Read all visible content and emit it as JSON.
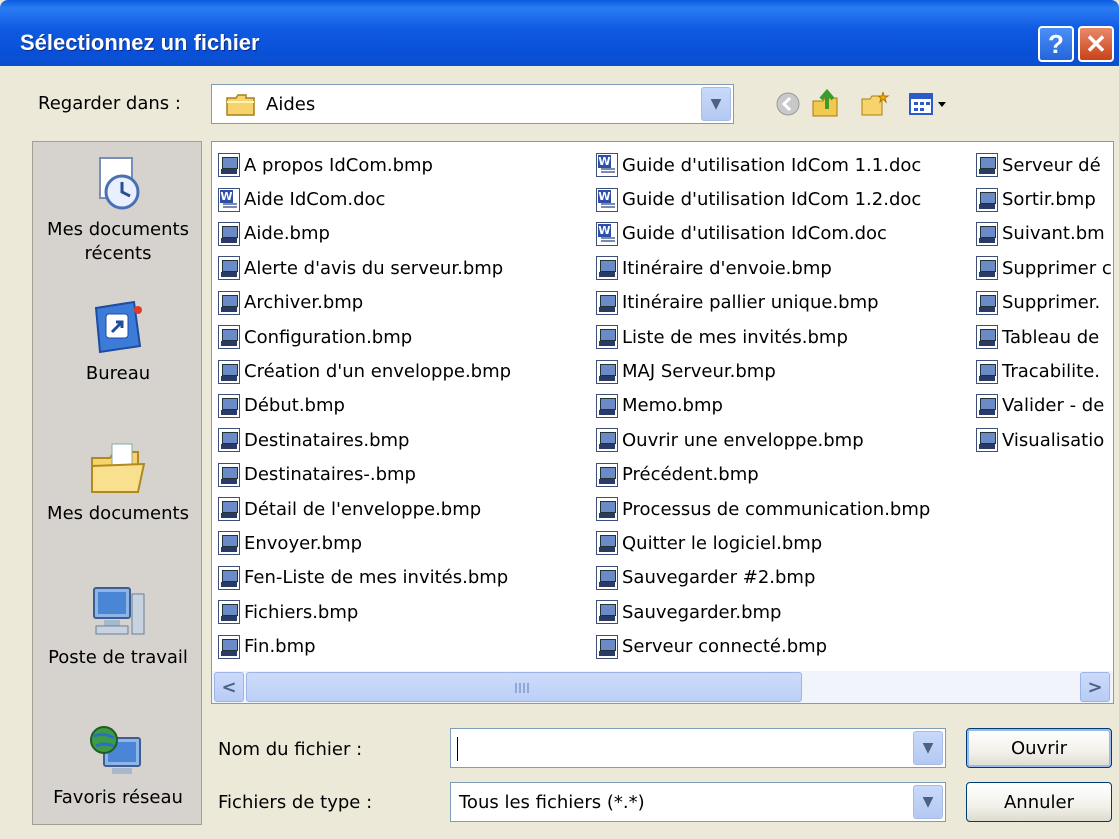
{
  "window": {
    "title": "Sélectionnez un fichier",
    "help_label": "?",
    "close_label": "✕"
  },
  "lookin": {
    "label": "Regarder dans :",
    "value": "Aides"
  },
  "toolbar": {
    "icons": [
      "back-icon",
      "up-folder-icon",
      "new-folder-icon",
      "view-menu-icon"
    ]
  },
  "places": [
    {
      "label1": "Mes documents",
      "label2": "récents",
      "icon": "recent-documents-icon"
    },
    {
      "label1": "Bureau",
      "label2": "",
      "icon": "desktop-icon"
    },
    {
      "label1": "Mes documents",
      "label2": "",
      "icon": "my-documents-icon"
    },
    {
      "label1": "Poste de travail",
      "label2": "",
      "icon": "my-computer-icon"
    },
    {
      "label1": "Favoris réseau",
      "label2": "",
      "icon": "network-places-icon"
    }
  ],
  "files": {
    "col1": [
      {
        "name": "A propos IdCom.bmp",
        "type": "bmp"
      },
      {
        "name": "Aide IdCom.doc",
        "type": "doc"
      },
      {
        "name": "Aide.bmp",
        "type": "bmp"
      },
      {
        "name": "Alerte d'avis du serveur.bmp",
        "type": "bmp"
      },
      {
        "name": "Archiver.bmp",
        "type": "bmp"
      },
      {
        "name": "Configuration.bmp",
        "type": "bmp"
      },
      {
        "name": "Création d'un enveloppe.bmp",
        "type": "bmp"
      },
      {
        "name": "Début.bmp",
        "type": "bmp"
      },
      {
        "name": "Destinataires.bmp",
        "type": "bmp"
      },
      {
        "name": "Destinataires-.bmp",
        "type": "bmp"
      },
      {
        "name": "Détail de l'enveloppe.bmp",
        "type": "bmp"
      },
      {
        "name": "Envoyer.bmp",
        "type": "bmp"
      },
      {
        "name": "Fen-Liste de mes invités.bmp",
        "type": "bmp"
      },
      {
        "name": "Fichiers.bmp",
        "type": "bmp"
      },
      {
        "name": "Fin.bmp",
        "type": "bmp"
      }
    ],
    "col2": [
      {
        "name": "Guide d'utilisation IdCom 1.1.doc",
        "type": "doc"
      },
      {
        "name": "Guide d'utilisation IdCom 1.2.doc",
        "type": "doc"
      },
      {
        "name": "Guide d'utilisation IdCom.doc",
        "type": "doc"
      },
      {
        "name": "Itinéraire d'envoie.bmp",
        "type": "bmp"
      },
      {
        "name": "Itinéraire pallier unique.bmp",
        "type": "bmp"
      },
      {
        "name": "Liste de mes invités.bmp",
        "type": "bmp"
      },
      {
        "name": "MAJ Serveur.bmp",
        "type": "bmp"
      },
      {
        "name": "Memo.bmp",
        "type": "bmp"
      },
      {
        "name": "Ouvrir une enveloppe.bmp",
        "type": "bmp"
      },
      {
        "name": "Précédent.bmp",
        "type": "bmp"
      },
      {
        "name": "Processus de communication.bmp",
        "type": "bmp"
      },
      {
        "name": "Quitter le logiciel.bmp",
        "type": "bmp"
      },
      {
        "name": "Sauvegarder #2.bmp",
        "type": "bmp"
      },
      {
        "name": "Sauvegarder.bmp",
        "type": "bmp"
      },
      {
        "name": "Serveur connecté.bmp",
        "type": "bmp"
      }
    ],
    "col3": [
      {
        "name": "Serveur dé",
        "type": "bmp"
      },
      {
        "name": "Sortir.bmp",
        "type": "bmp"
      },
      {
        "name": "Suivant.bm",
        "type": "bmp"
      },
      {
        "name": "Supprimer c",
        "type": "bmp"
      },
      {
        "name": "Supprimer.",
        "type": "bmp"
      },
      {
        "name": "Tableau de",
        "type": "bmp"
      },
      {
        "name": "Tracabilite.",
        "type": "bmp"
      },
      {
        "name": "Valider - de",
        "type": "bmp"
      },
      {
        "name": "Visualisatio",
        "type": "bmp"
      }
    ]
  },
  "scrollbar": {
    "left_arrow": "<",
    "right_arrow": ">"
  },
  "filename": {
    "label": "Nom du fichier :",
    "value": ""
  },
  "filetype": {
    "label": "Fichiers de type :",
    "value": "Tous les fichiers (*.*)"
  },
  "buttons": {
    "open": "Ouvrir",
    "cancel": "Annuler"
  }
}
